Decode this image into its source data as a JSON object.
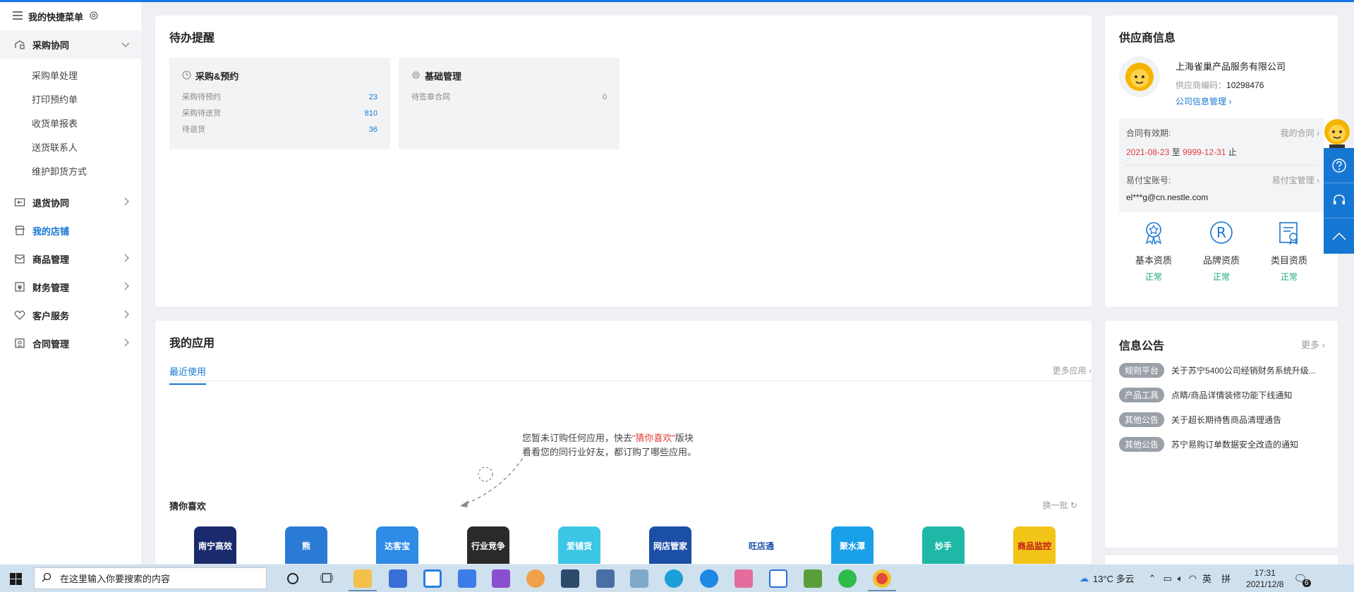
{
  "sidebar": {
    "quick_menu": "我的快捷菜单",
    "purchase": "采购协同",
    "sub_items": [
      "采购单处理",
      "打印预约单",
      "收货单报表",
      "送货联系人",
      "维护卸货方式"
    ],
    "menus": [
      {
        "label": "退货协同",
        "icon": "return-icon"
      },
      {
        "label": "我的店铺",
        "icon": "store-icon"
      },
      {
        "label": "商品管理",
        "icon": "goods-icon"
      },
      {
        "label": "财务管理",
        "icon": "finance-icon"
      },
      {
        "label": "客户服务",
        "icon": "service-icon"
      },
      {
        "label": "合同管理",
        "icon": "contract-icon"
      }
    ]
  },
  "todo": {
    "title": "待办提醒",
    "card1": {
      "title": "采购&预约",
      "rows": [
        {
          "label": "采购待预约",
          "value": "23"
        },
        {
          "label": "采购待送货",
          "value": "810"
        },
        {
          "label": "待退货",
          "value": "36"
        }
      ]
    },
    "card2": {
      "title": "基础管理",
      "rows": [
        {
          "label": "待签章合同",
          "value": "0"
        }
      ]
    }
  },
  "apps": {
    "title": "我的应用",
    "tab": "最近使用",
    "more": "更多应用",
    "empty_line1_pre": "您暂未订购任何应用，快去",
    "empty_highlight": "“猜你喜欢”",
    "empty_line1_post": "版块",
    "empty_line2": "看看您的同行业好友，都订购了哪些应用。",
    "guess_title": "猜你喜欢",
    "refresh": "换一批",
    "tiles": [
      {
        "text": "南宁高效",
        "bg": "#1a2a6c"
      },
      {
        "text": "熊",
        "bg": "#2b7bd6"
      },
      {
        "text": "达客宝",
        "bg": "#2e8be6"
      },
      {
        "text": "行业竞争",
        "bg": "#2a2a2a"
      },
      {
        "text": "爱铺货",
        "bg": "#3cc6e6"
      },
      {
        "text": "网店管家",
        "bg": "#1c4fa6"
      },
      {
        "text": "旺店通",
        "bg": "#ffffff"
      },
      {
        "text": "聚水潭",
        "bg": "#1aa0e8"
      },
      {
        "text": "妙手",
        "bg": "#1fb7a6"
      },
      {
        "text": "商品监控",
        "bg": "#f2c418"
      }
    ]
  },
  "supplier": {
    "title": "供应商信息",
    "company": "上海雀巢产品服务有限公司",
    "code_label": "供应商编码：",
    "code": "10298476",
    "manage_link": "公司信息管理",
    "contract_label": "合同有效期:",
    "contract_link": "我的合同",
    "date_start": "2021-08-23",
    "date_to": "至",
    "date_end": "9999-12-31",
    "date_stop": "止",
    "pay_label": "易付宝账号:",
    "pay_link": "易付宝管理",
    "pay_account": "el***g@cn.nestle.com",
    "qualifications": [
      {
        "label": "基本资质",
        "status": "正常"
      },
      {
        "label": "品牌资质",
        "status": "正常"
      },
      {
        "label": "类目资质",
        "status": "正常"
      }
    ]
  },
  "notices": {
    "title": "信息公告",
    "more": "更多",
    "items": [
      {
        "tag": "规则平台",
        "text": "关于苏宁5400公司经销财务系统升级..."
      },
      {
        "tag": "产品工具",
        "text": "点睛/商品详情装修功能下线通知"
      },
      {
        "tag": "其他公告",
        "text": "关于超长期待售商品清理通告"
      },
      {
        "tag": "其他公告",
        "text": "苏宁易购订单数据安全改造的通知"
      }
    ]
  },
  "taskbar": {
    "search_placeholder": "在这里输入你要搜索的内容",
    "weather": "13°C 多云",
    "ime": "英",
    "time": "17:31",
    "date": "2021/12/8",
    "notif_count": "6"
  },
  "colors": {
    "accent": "#1677d2",
    "red": "#e23c3c",
    "green": "#19a974"
  }
}
